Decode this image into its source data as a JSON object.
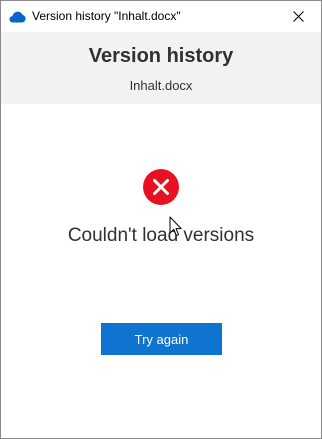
{
  "window": {
    "title": "Version history \"Inhalt.docx\"",
    "app_icon": "onedrive-cloud-icon",
    "close_icon": "close-icon"
  },
  "header": {
    "title": "Version history",
    "filename": "Inhalt.docx"
  },
  "error": {
    "icon": "error-x-icon",
    "message": "Couldn't load versions"
  },
  "actions": {
    "retry_label": "Try again"
  },
  "colors": {
    "accent": "#0f73d0",
    "error": "#e81123",
    "header_bg": "#f3f2f1",
    "onedrive": "#0a64c8"
  }
}
